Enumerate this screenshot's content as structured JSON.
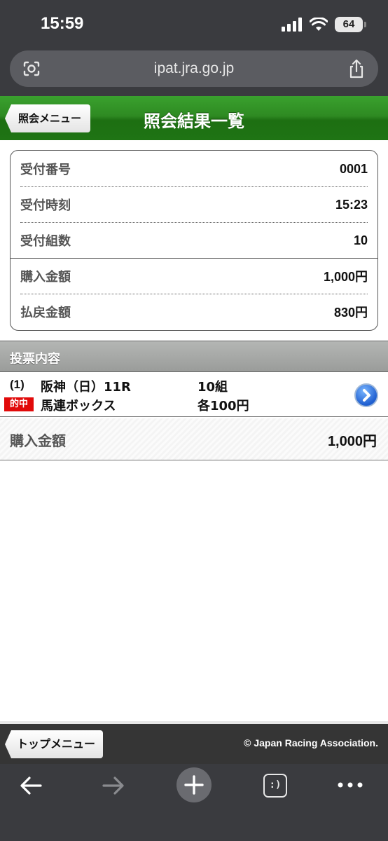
{
  "status_bar": {
    "time": "15:59",
    "battery": "64"
  },
  "browser": {
    "url": "ipat.jra.go.jp",
    "tabs_label": ":)"
  },
  "header": {
    "back_label": "照会メニュー",
    "title": "照会結果一覧"
  },
  "summary": {
    "rows": [
      {
        "label": "受付番号",
        "value": "0001"
      },
      {
        "label": "受付時刻",
        "value": "15:23"
      },
      {
        "label": "受付組数",
        "value": "10"
      },
      {
        "label": "購入金額",
        "value": "1,000円"
      },
      {
        "label": "払戻金額",
        "value": "830円"
      }
    ]
  },
  "section": {
    "title": "投票内容"
  },
  "bets": [
    {
      "number": "(1)",
      "badge": "的中",
      "venue": "阪神（日）11R",
      "bet_type": "馬連ボックス",
      "count": "10組",
      "each": "各100円"
    }
  ],
  "total": {
    "label": "購入金額",
    "value": "1,000円"
  },
  "footer": {
    "top_menu_label": "トップメニュー",
    "copyright": "© Japan Racing Association."
  },
  "colors": {
    "header_green": "#2e8a22",
    "hit_red": "#e10a0a",
    "chrome": "#3a3b3f"
  }
}
